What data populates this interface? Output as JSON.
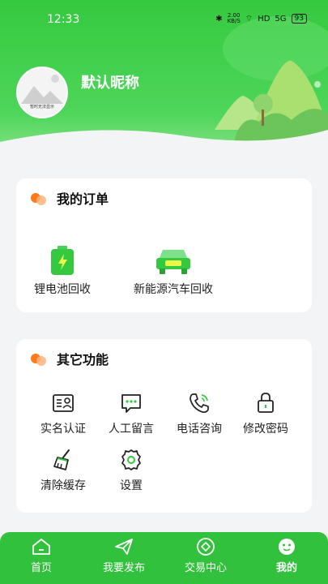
{
  "status_bar": {
    "time": "12:33",
    "net_speed": "2.00",
    "net_unit": "KB/S",
    "hd": "HD",
    "signal": "5G",
    "battery": "93"
  },
  "profile": {
    "nickname": "默认昵称",
    "avatar_caption": "暂时无法显示"
  },
  "orders": {
    "title": "我的订单",
    "items": [
      {
        "label": "锂电池回收",
        "icon": "battery-icon"
      },
      {
        "label": "新能源汽车回收",
        "icon": "car-icon"
      }
    ]
  },
  "functions": {
    "title": "其它功能",
    "items": [
      {
        "label": "实名认证",
        "icon": "id-card-icon"
      },
      {
        "label": "人工留言",
        "icon": "message-icon"
      },
      {
        "label": "电话咨询",
        "icon": "phone-icon"
      },
      {
        "label": "修改密码",
        "icon": "lock-icon"
      },
      {
        "label": "清除缓存",
        "icon": "brush-icon"
      },
      {
        "label": "设置",
        "icon": "gear-icon"
      }
    ]
  },
  "tabbar": {
    "items": [
      {
        "label": "首页",
        "icon": "home-icon"
      },
      {
        "label": "我要发布",
        "icon": "send-icon"
      },
      {
        "label": "交易中心",
        "icon": "trade-icon"
      },
      {
        "label": "我的",
        "icon": "profile-icon"
      }
    ]
  },
  "colors": {
    "primary": "#32c13c",
    "accent_orange": "#ff7a1a"
  }
}
